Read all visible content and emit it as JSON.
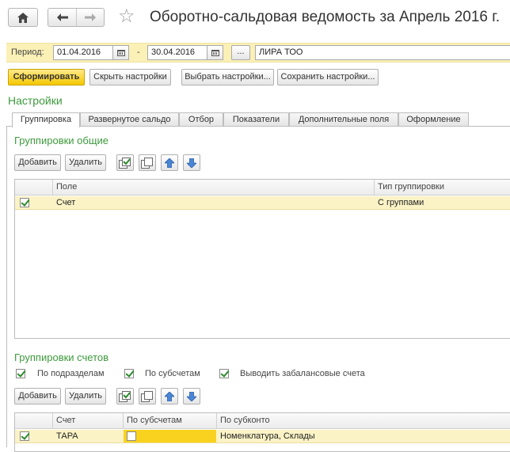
{
  "header": {
    "title": "Оборотно-сальдовая ведомость  за Апрель 2016 г."
  },
  "period": {
    "label": "Период:",
    "from": "01.04.2016",
    "dash": "-",
    "to": "30.04.2016",
    "dots_label": "...",
    "organization": "ЛИРА ТОО"
  },
  "toolbar": {
    "form_label": "Сформировать",
    "hide_settings_label": "Скрыть настройки",
    "choose_settings_label": "Выбрать настройки...",
    "save_settings_label": "Сохранить настройки..."
  },
  "settings": {
    "title": "Настройки",
    "tabs": [
      {
        "label": "Группировка"
      },
      {
        "label": "Развернутое сальдо"
      },
      {
        "label": "Отбор"
      },
      {
        "label": "Показатели"
      },
      {
        "label": "Дополнительные поля"
      },
      {
        "label": "Оформление"
      }
    ]
  },
  "general_groupings": {
    "title": "Группировки общие",
    "add_label": "Добавить",
    "delete_label": "Удалить",
    "columns": [
      "Поле",
      "Тип группировки"
    ],
    "rows": [
      {
        "checked": true,
        "field": "Счет",
        "type": "С группами"
      }
    ]
  },
  "account_groupings": {
    "title": "Группировки счетов",
    "options": [
      {
        "label": "По подразделам",
        "checked": true
      },
      {
        "label": "По субсчетам",
        "checked": true
      },
      {
        "label": "Выводить забалансовые счета",
        "checked": true
      }
    ],
    "add_label": "Добавить",
    "delete_label": "Удалить",
    "columns": [
      "Счет",
      "По субсчетам",
      "По субконто"
    ],
    "rows": [
      {
        "checked": true,
        "account": "ТАРА",
        "by_subaccounts": false,
        "by_subconto": "Номенклатура, Склады"
      }
    ]
  },
  "colors": {
    "accent_green": "#3d9a3d",
    "period_bg": "#fbf0b6",
    "primary_button": "#f4c800",
    "selected_row": "#fbf3c6"
  }
}
